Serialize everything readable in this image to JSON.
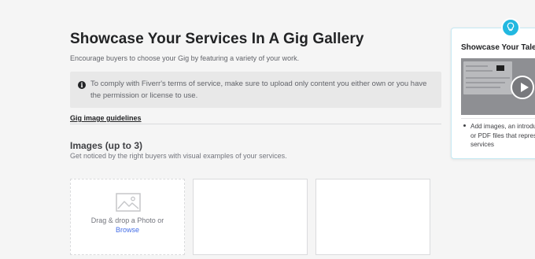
{
  "header": {
    "title": "Showcase Your Services In A Gig Gallery",
    "subtitle": "Encourage buyers to choose your Gig by featuring a variety of your work."
  },
  "notice": {
    "icon": "info-icon",
    "text": "To comply with Fiverr's terms of service, make sure to upload only content you either own or you have the permission or license to use."
  },
  "guidelines_link": "Gig image guidelines",
  "images_section": {
    "title": "Images (up to 3)",
    "description": "Get noticed by the right buyers with visual examples of your services.",
    "drop_text": "Drag & drop a Photo or",
    "browse_label": "Browse"
  },
  "tip": {
    "icon": "lightbulb-icon",
    "title": "Showcase Your Talents",
    "bullet_text": "Add images, an introduction video, or PDF files that represent your services"
  },
  "colors": {
    "accent": "#22b8e0",
    "link": "#446ee7",
    "background": "#f5f5f5"
  }
}
